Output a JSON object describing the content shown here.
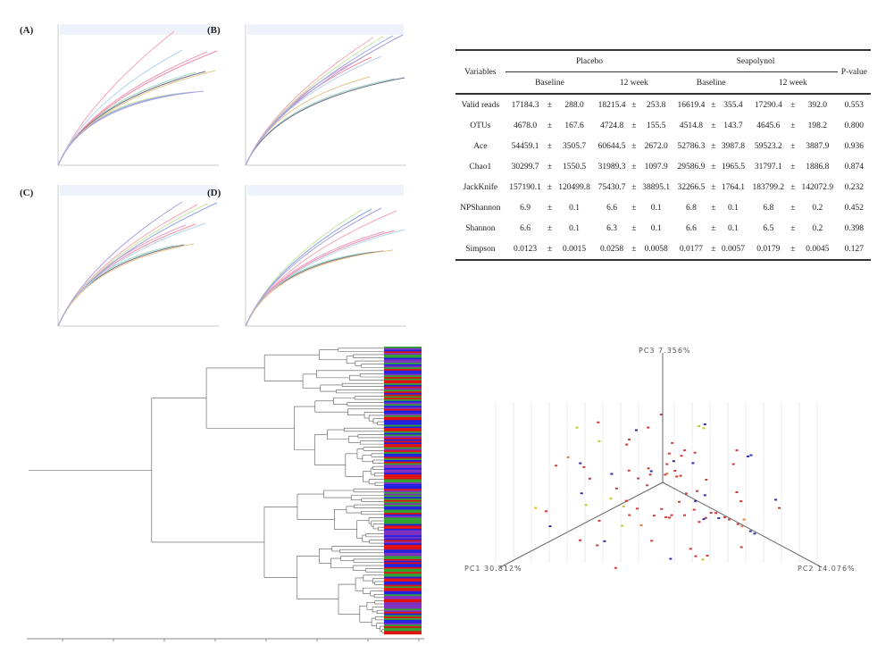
{
  "panels": {
    "a": "(A)",
    "b": "(B)",
    "c": "(C)",
    "d": "(D)"
  },
  "curve_colors": [
    "#f4a6b8",
    "#f29ac0",
    "#9ed9c2",
    "#c9e3a0",
    "#f28da5",
    "#6d6d8a",
    "#8fa6e6",
    "#b3d4ef",
    "#e8c48a",
    "#a7a0e0"
  ],
  "table": {
    "variables_label": "Variables",
    "pvalue_label": "P-value",
    "groups": [
      "Placebo",
      "Seapolynol"
    ],
    "subheaders": [
      "Baseline",
      "12 week",
      "Baseline",
      "12 week"
    ],
    "pm": "±",
    "rows": [
      {
        "name": "Valid reads",
        "v": [
          [
            "17184.3",
            "288.0"
          ],
          [
            "18215.4",
            "253.8"
          ],
          [
            "16619.4",
            "355.4"
          ],
          [
            "17290.4",
            "392.0"
          ]
        ],
        "p": "0.553"
      },
      {
        "name": "OTUs",
        "v": [
          [
            "4678.0",
            "167.6"
          ],
          [
            "4724.8",
            "155.5"
          ],
          [
            "4514.8",
            "143.7"
          ],
          [
            "4645.6",
            "198.2"
          ]
        ],
        "p": "0.800"
      },
      {
        "name": "Ace",
        "v": [
          [
            "54459.1",
            "3505.7"
          ],
          [
            "60644.5",
            "2672.0"
          ],
          [
            "52786.3",
            "3987.8"
          ],
          [
            "59523.2",
            "3887.9"
          ]
        ],
        "p": "0.936"
      },
      {
        "name": "Chao1",
        "v": [
          [
            "30299.7",
            "1550.5"
          ],
          [
            "31989.3",
            "1097.9"
          ],
          [
            "29586.9",
            "1965.5"
          ],
          [
            "31797.1",
            "1886.8"
          ]
        ],
        "p": "0.874"
      },
      {
        "name": "JackKnife",
        "v": [
          [
            "157190.1",
            "120499.8"
          ],
          [
            "75430.7",
            "38895.1"
          ],
          [
            "32266.5",
            "1764.1"
          ],
          [
            "183799.2",
            "142072.9"
          ]
        ],
        "p": "0.232"
      },
      {
        "name": "NPShannon",
        "v": [
          [
            "6.9",
            "0.1"
          ],
          [
            "6.6",
            "0.1"
          ],
          [
            "6.8",
            "0.1"
          ],
          [
            "6.8",
            "0.2"
          ]
        ],
        "p": "0.452"
      },
      {
        "name": "Shannon",
        "v": [
          [
            "6.6",
            "0.1"
          ],
          [
            "6.3",
            "0.1"
          ],
          [
            "6.6",
            "0.1"
          ],
          [
            "6.5",
            "0.2"
          ]
        ],
        "p": "0.398"
      },
      {
        "name": "Simpson",
        "v": [
          [
            "0.0123",
            "0.0015"
          ],
          [
            "0.0258",
            "0.0058"
          ],
          [
            "0.0177",
            "0.0057"
          ],
          [
            "0.0179",
            "0.0045"
          ]
        ],
        "p": "0.127"
      }
    ]
  },
  "pcoa": {
    "pc1": "PC1 30.812%",
    "pc2": "PC2 14.076%",
    "pc3": "PC3 7.356%",
    "colors": [
      "#d23a3a",
      "#2b2fa8",
      "#c8c820",
      "#e07a3a"
    ]
  },
  "dendrogram": {
    "bar_colors": [
      "#e01010",
      "#2020e0",
      "#30a030",
      "#8030c0"
    ]
  }
}
